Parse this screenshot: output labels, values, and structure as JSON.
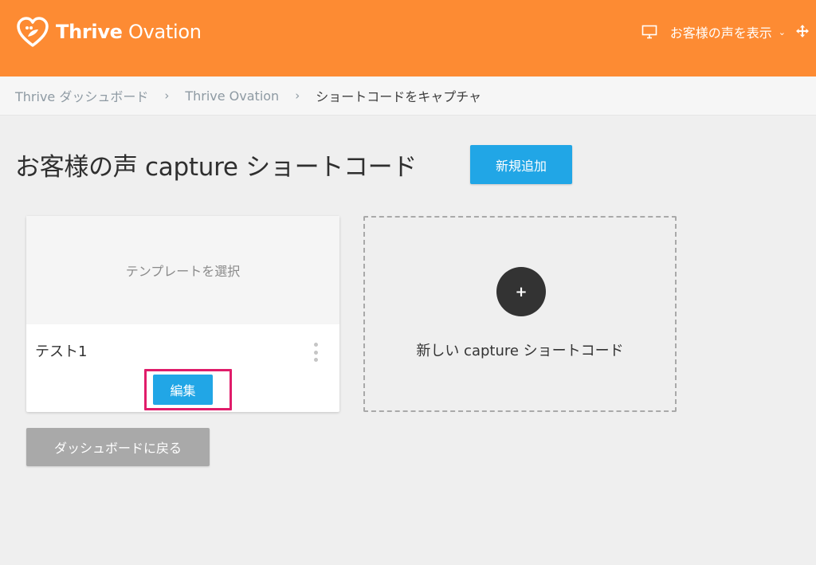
{
  "colors": {
    "header_bg": "#fd8b33",
    "primary_button": "#21a6e6",
    "highlight_border": "#e01c6a",
    "back_button": "#a9a9a9",
    "page_bg": "#efefef"
  },
  "header": {
    "logo_icon": "heart-leaf-icon",
    "brand_bold": "Thrive",
    "brand_light": "Ovation",
    "testimonials_icon": "monitor-icon",
    "testimonials_menu": "お客様の声を表示",
    "dropdown_icon": "chevron-down-icon",
    "move_icon": "move-arrows-icon"
  },
  "breadcrumb": {
    "items": [
      {
        "label": "Thrive ダッシュボード"
      },
      {
        "label": "Thrive Ovation"
      },
      {
        "label": "ショートコードをキャプチャ"
      }
    ],
    "separator": "›"
  },
  "main": {
    "title": "お客様の声 capture ショートコード",
    "add_new_label": "新規追加",
    "card": {
      "preview_text": "テンプレートを選択",
      "name": "テスト1",
      "menu_icon": "more-vertical-icon",
      "edit_label": "編集"
    },
    "new_card": {
      "plus": "+",
      "label": "新しい capture ショートコード"
    },
    "back_label": "ダッシュボードに戻る"
  }
}
